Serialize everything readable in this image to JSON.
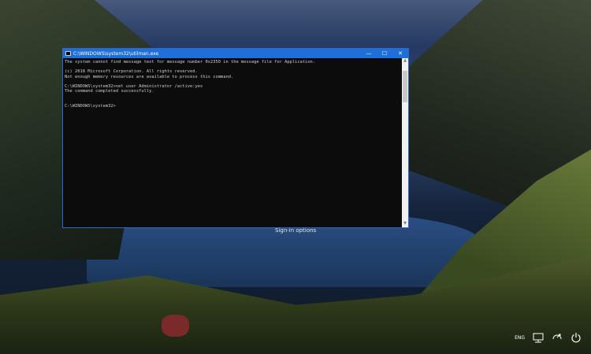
{
  "window": {
    "title": "C:\\WINDOWS\\system32\\utilman.exe",
    "controls": {
      "minimize": "—",
      "maximize": "☐",
      "close": "✕"
    }
  },
  "console_lines": [
    "The system cannot find message text for message number 0x2350 in the message file for Application.",
    "",
    "(c) 2018 Microsoft Corporation. All rights reserved.",
    "Not enough memory resources are available to process this command.",
    "",
    "C:\\WINDOWS\\system32>net user Administrator /active:yes",
    "The command completed successfully.",
    "",
    "",
    "C:\\WINDOWS\\system32>"
  ],
  "lockscreen": {
    "signin_label": "Sign-in options",
    "language": "ENG"
  },
  "icons": {
    "network": "network-icon",
    "ease_of_access": "ease-of-access-icon",
    "power": "power-icon"
  }
}
